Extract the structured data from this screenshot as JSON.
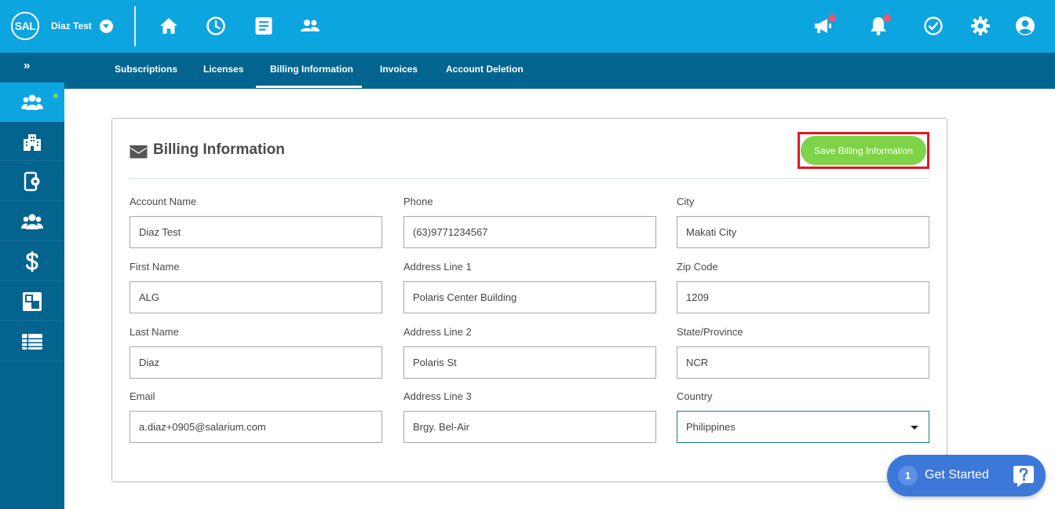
{
  "app": {
    "logo_text": "SAL",
    "company_name": "Diaz Test"
  },
  "top_nav": {
    "left_icons": [
      "home-icon",
      "clock-icon",
      "document-icon",
      "people-icon"
    ],
    "right_icons": [
      "megaphone-icon",
      "bell-icon",
      "check-circle-icon",
      "gear-icon",
      "user-icon"
    ]
  },
  "tabs": [
    {
      "label": "Subscriptions",
      "active": false
    },
    {
      "label": "Licenses",
      "active": false
    },
    {
      "label": "Billing Information",
      "active": true
    },
    {
      "label": "Invoices",
      "active": false
    },
    {
      "label": "Account Deletion",
      "active": false
    }
  ],
  "sidebar": {
    "collapse_label": "»",
    "items": [
      "team-icon",
      "building-icon",
      "mobile-settings-icon",
      "group-icon",
      "dollar-icon",
      "layers-icon",
      "list-icon"
    ]
  },
  "billing": {
    "title": "Billing Information",
    "save_label": "Save Billing Information",
    "fields": {
      "account_name": {
        "label": "Account Name",
        "value": "Diaz Test"
      },
      "phone": {
        "label": "Phone",
        "value": "(63)9771234567"
      },
      "city": {
        "label": "City",
        "value": "Makati City"
      },
      "first_name": {
        "label": "First Name",
        "value": "ALG"
      },
      "address1": {
        "label": "Address Line 1",
        "value": "Polaris Center Building"
      },
      "zip": {
        "label": "Zip Code",
        "value": "1209"
      },
      "last_name": {
        "label": "Last Name",
        "value": "Diaz"
      },
      "address2": {
        "label": "Address Line 2",
        "value": "Polaris St"
      },
      "state": {
        "label": "State/Province",
        "value": "NCR"
      },
      "email": {
        "label": "Email",
        "value": "a.diaz+0905@salarium.com"
      },
      "address3": {
        "label": "Address Line 3",
        "value": "Brgy. Bel-Air"
      },
      "country": {
        "label": "Country",
        "value": "Philippines"
      }
    }
  },
  "get_started": {
    "badge": "1",
    "label": "Get Started"
  },
  "colors": {
    "top_bar": "#0da5e0",
    "nav_dark": "#03648f",
    "save_button": "#7ed348",
    "highlight": "#e01822",
    "notification_dot": "#e85a6b",
    "widget": "#3c78d8"
  }
}
